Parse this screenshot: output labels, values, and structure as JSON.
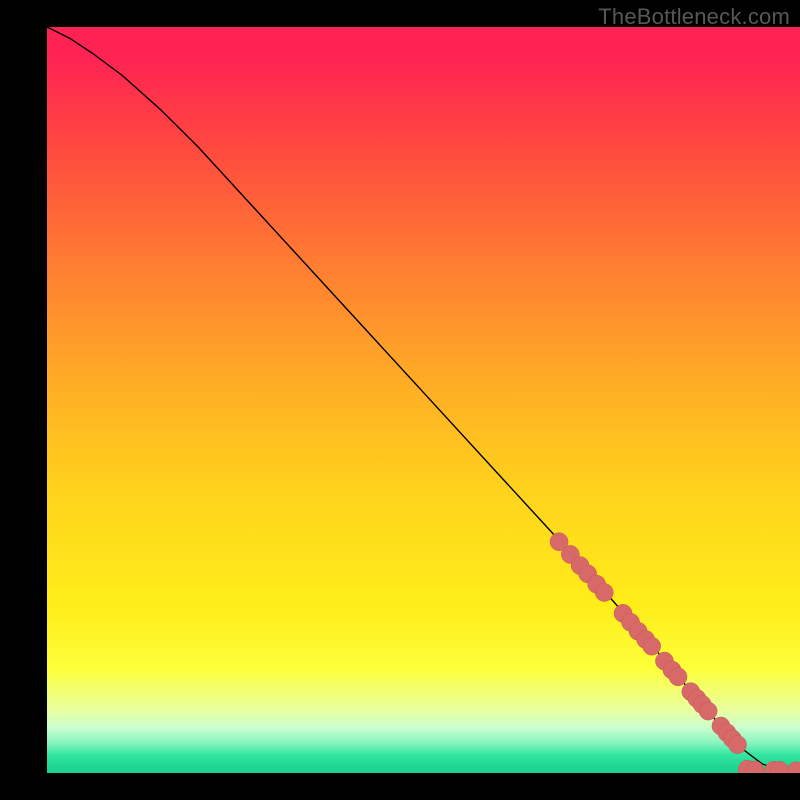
{
  "watermark": "TheBottleneck.com",
  "colors": {
    "dot_fill": "#d76a68",
    "dot_stroke": "#c95553",
    "line": "#000000",
    "background": "#000000"
  },
  "chart_data": {
    "type": "line",
    "title": "",
    "xlabel": "",
    "ylabel": "",
    "xlim": [
      0,
      100
    ],
    "ylim": [
      0,
      100
    ],
    "grid": false,
    "legend": false,
    "series": [
      {
        "name": "curve",
        "x": [
          0,
          3,
          6,
          10,
          15,
          20,
          30,
          40,
          50,
          60,
          70,
          80,
          88,
          92,
          95,
          97,
          99,
          100
        ],
        "y": [
          100,
          98.5,
          96.5,
          93.5,
          89,
          84,
          73,
          62,
          51,
          40,
          29,
          17.5,
          8,
          3.5,
          1.2,
          0.5,
          0.3,
          0.3
        ]
      }
    ],
    "markers": [
      {
        "x": 68,
        "y": 31
      },
      {
        "x": 69.5,
        "y": 29.3
      },
      {
        "x": 70.8,
        "y": 27.8
      },
      {
        "x": 71.8,
        "y": 26.7
      },
      {
        "x": 73,
        "y": 25.3
      },
      {
        "x": 74,
        "y": 24.2
      },
      {
        "x": 76.5,
        "y": 21.4
      },
      {
        "x": 77.5,
        "y": 20.2
      },
      {
        "x": 78.5,
        "y": 19
      },
      {
        "x": 79.5,
        "y": 17.9
      },
      {
        "x": 80.3,
        "y": 17
      },
      {
        "x": 82,
        "y": 15
      },
      {
        "x": 83,
        "y": 13.8
      },
      {
        "x": 83.8,
        "y": 12.9
      },
      {
        "x": 85.5,
        "y": 10.9
      },
      {
        "x": 86.3,
        "y": 10
      },
      {
        "x": 87,
        "y": 9.2
      },
      {
        "x": 87.8,
        "y": 8.3
      },
      {
        "x": 89.5,
        "y": 6.3
      },
      {
        "x": 90.3,
        "y": 5.4
      },
      {
        "x": 91,
        "y": 4.6
      },
      {
        "x": 91.7,
        "y": 3.8
      },
      {
        "x": 93,
        "y": 0.5
      },
      {
        "x": 94,
        "y": 0.4
      },
      {
        "x": 96.5,
        "y": 0.35
      },
      {
        "x": 97.3,
        "y": 0.35
      },
      {
        "x": 99.5,
        "y": 0.3
      }
    ],
    "marker_radius_px": 9
  }
}
